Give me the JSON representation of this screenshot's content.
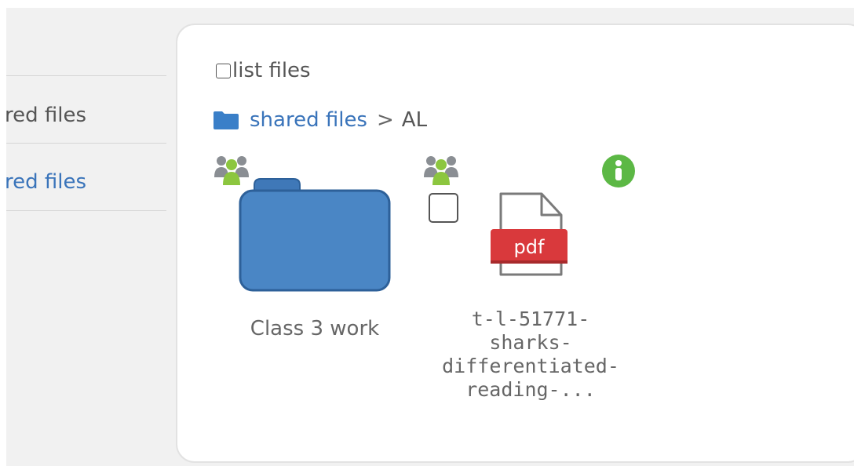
{
  "sidebar": {
    "items": [
      {
        "label": "shared files",
        "selected": false,
        "color": "#555555"
      },
      {
        "label": "Shared files",
        "selected": true,
        "color": "#3a74ba"
      }
    ]
  },
  "toolbar": {
    "list_files_label": "list files",
    "list_files_checked": false
  },
  "breadcrumb": {
    "root": "shared files",
    "separator": ">",
    "current": "AL"
  },
  "files": [
    {
      "name": "Class 3 work",
      "type": "folder",
      "shared": true
    },
    {
      "name": "t-l-51771-sharks-differentiated-reading-...",
      "type": "pdf",
      "shared": true,
      "selected": false,
      "lines": [
        "t-l-51771-",
        "sharks-",
        "differentiated-",
        "reading-..."
      ],
      "badge": "pdf"
    }
  ],
  "colors": {
    "accent": "#3a74ba",
    "folder": "#4a86c5",
    "shared_icon": "#8cc63f",
    "pdf_badge": "#d9393c",
    "info": "#5cb845"
  }
}
